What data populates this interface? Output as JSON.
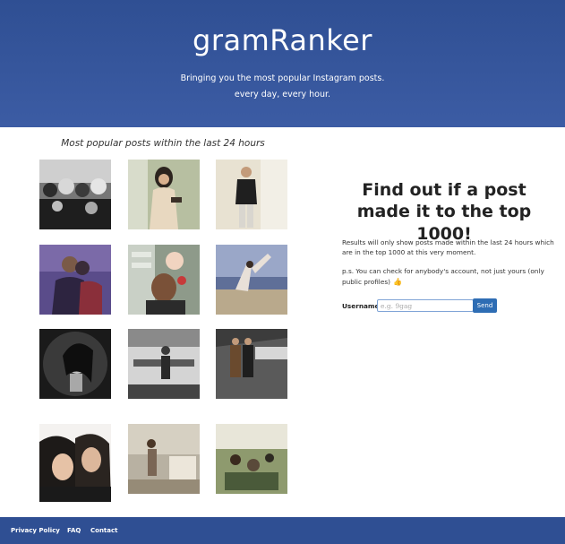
{
  "header": {
    "title": "gramRanker",
    "tagline_line1": "Bringing you the most popular Instagram posts.",
    "tagline_line2": "every day, every hour."
  },
  "posts_section": {
    "caption": "Most popular posts within the last 24 hours",
    "posts": [
      {
        "id": "1",
        "icon": "crowd-selfie-photo"
      },
      {
        "id": "2",
        "icon": "woman-posing-photo"
      },
      {
        "id": "3",
        "icon": "man-leather-jacket-photo"
      },
      {
        "id": "4",
        "icon": "couple-hug-photo"
      },
      {
        "id": "5",
        "icon": "man-holding-baby-photo"
      },
      {
        "id": "6",
        "icon": "beach-pose-photo"
      },
      {
        "id": "7",
        "icon": "bw-portrait-photo"
      },
      {
        "id": "8",
        "icon": "bw-mirror-photo"
      },
      {
        "id": "9",
        "icon": "two-people-standing-photo"
      },
      {
        "id": "10",
        "icon": "sisters-selfie-photo"
      },
      {
        "id": "11",
        "icon": "mirror-room-photo"
      },
      {
        "id": "12",
        "icon": "group-outdoors-photo"
      }
    ]
  },
  "search": {
    "heading": "Find out if a post made it to the top 1000!",
    "note1": "Results will only show posts made within the last 24 hours which are in the top 1000 at this very moment.",
    "note2": "p.s. You can check for anybody's account, not just yours (only public profiles)",
    "thumb_glyph": "👍",
    "username_label": "Username:",
    "username_value": "",
    "username_placeholder": "e.g. 9gag",
    "send_label": "Send"
  },
  "footer": {
    "privacy": "Privacy Policy",
    "faq": "FAQ",
    "contact": "Contact"
  },
  "colors": {
    "header_bg": "#2f4f93",
    "button_bg": "#2e6db4"
  }
}
